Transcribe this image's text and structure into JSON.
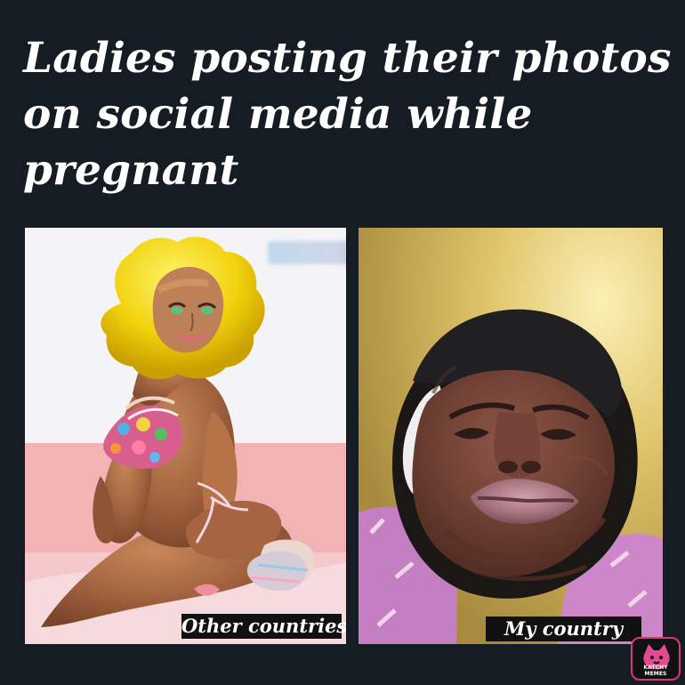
{
  "headline": "Ladies posting their photos on social media while pregnant",
  "panels": {
    "left_caption": "Other countries",
    "right_caption": "My country"
  },
  "watermark": {
    "text": "KATCHY MEMES"
  },
  "colors": {
    "background": "#151c24",
    "headline": "#ffffff",
    "caption_bg": "#111111",
    "caption_text": "#ffffff",
    "watermark_pink": "#e44b8f"
  }
}
